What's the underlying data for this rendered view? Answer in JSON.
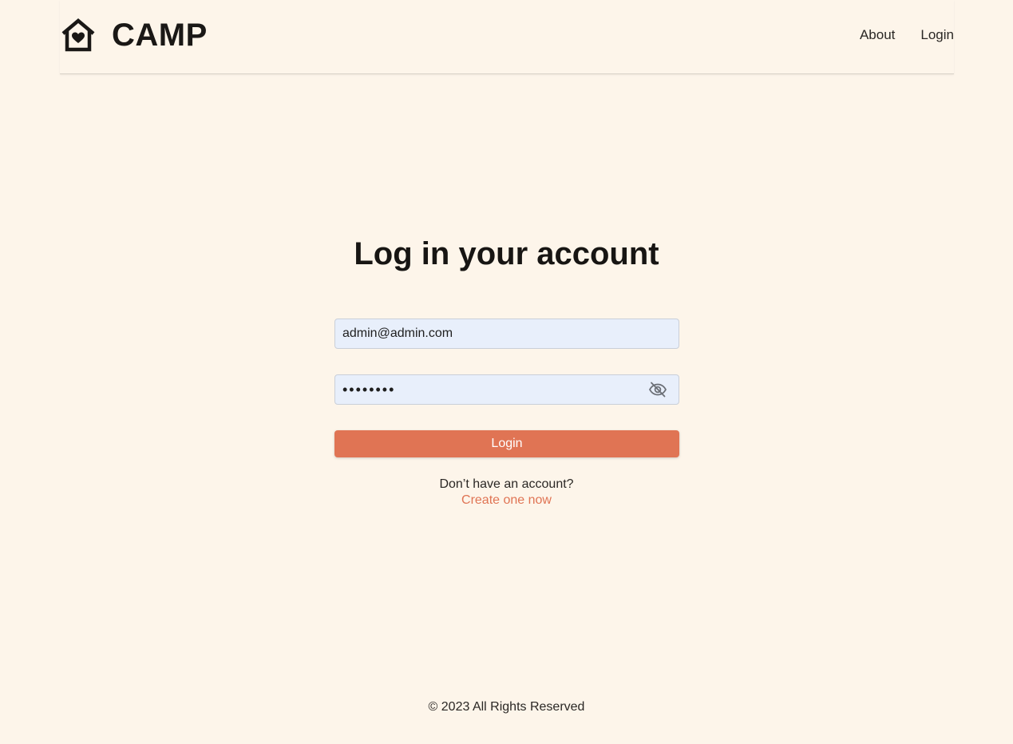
{
  "header": {
    "brand_name": "CAMP",
    "logo_icon": "house-heart-icon",
    "nav": {
      "about_label": "About",
      "login_label": "Login"
    }
  },
  "main": {
    "title": "Log in your account",
    "email": {
      "value": "admin@admin.com"
    },
    "password": {
      "value": "••••••••",
      "toggle_icon": "eye-slash-icon"
    },
    "login_button_label": "Login",
    "signup_prompt": "Don’t have an account?",
    "signup_link_label": "Create one now"
  },
  "footer": {
    "text": "© 2023 All Rights Reserved"
  },
  "colors": {
    "background": "#fdf5ea",
    "accent": "#e07454",
    "input_background": "#e8effb"
  }
}
